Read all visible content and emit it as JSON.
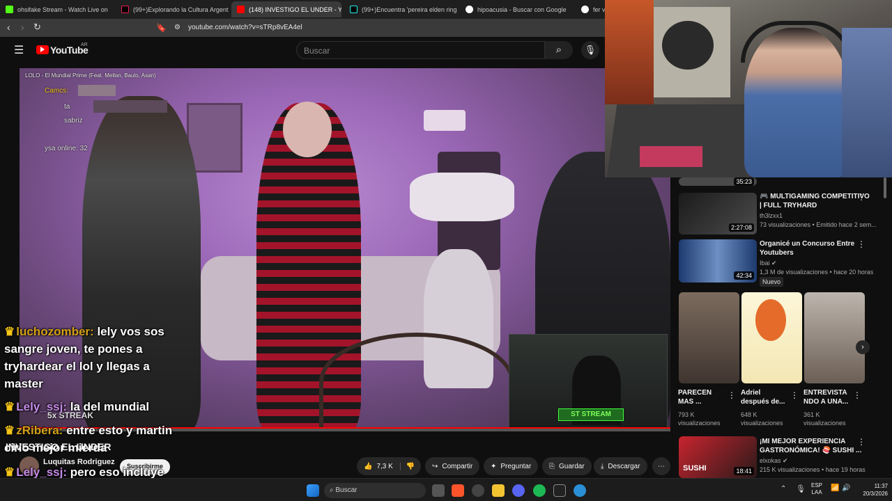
{
  "browser": {
    "tabs": [
      {
        "title": "ohsifake Stream - Watch Live on",
        "active": false
      },
      {
        "title": "(99+)Explorando la Cultura Argentina",
        "active": false
      },
      {
        "title": "(148) INVESTIGO EL UNDER - You",
        "active": true
      },
      {
        "title": "(99+)Encuentra 'pereira elden ring'",
        "active": false
      },
      {
        "title": "hipoacusia - Buscar con Google",
        "active": false
      },
      {
        "title": "fer vaz",
        "active": false
      }
    ],
    "url": "youtube.com/watch?v=sTRp8vEA4el"
  },
  "youtube": {
    "logo_text": "YouTube",
    "region": "AR",
    "search_placeholder": "Buscar"
  },
  "video": {
    "overlay_song": "LOLO - El Mundial Prime (Feat. Mellan, Baulo, Asan)",
    "overlay_users": [
      "Camcs:",
      "ta",
      "sabriz",
      "ysa online: 32"
    ],
    "streak": "5x STREAK",
    "cam_label": "ST STREAM",
    "chat": [
      {
        "user": "luchozomber:",
        "text": "lely vos sos sangre joven, te pones a tryhardear el lol y llegas a master"
      },
      {
        "user": "Lely_ssj:",
        "text": "la del mundial"
      },
      {
        "user": "zRibera:",
        "text": "entre esto y martin cirio mejor mierda"
      },
      {
        "user": "Lely_ssj:",
        "text": "pero eso incluye engordar y no me va"
      }
    ]
  },
  "channel": {
    "name": "Luquitas Rodriguez",
    "subscribe": "Suscribirme",
    "video_title": "INVESTIGO EL UNDER"
  },
  "actions": {
    "likes": "7,3 K",
    "share": "Compartir",
    "ask": "Preguntar",
    "save": "Guardar",
    "download": "Descargar"
  },
  "sidebar": {
    "top_duration": "35:23",
    "items": [
      {
        "title": "MULTIGAMING COMPETITIVO | FULL TRYHARD",
        "channel": "th3lzxx1",
        "meta": "73 visualizaciones • Emitido hace 2 sem...",
        "duration": "2:27:08",
        "badge": ""
      },
      {
        "title": "Organicé un Concurso Entre Youtubers",
        "channel": "Ibai",
        "meta": "1,3 M de visualizaciones • hace 20 horas",
        "duration": "42:34",
        "badge": "Nuevo"
      }
    ],
    "shorts": [
      {
        "title": "PARECEN MAS ...",
        "views": "793 K visualizaciones"
      },
      {
        "title": "Adriel después de...",
        "views": "648 K visualizaciones"
      },
      {
        "title": "ENTREVISTA NDO A UNA...",
        "views": "361 K visualizaciones"
      }
    ],
    "bottom": {
      "title": "¡MI MEJOR EXPERIENCIA GASTRONÓMICA! 🍣 SUSHI ...",
      "channel": "elxokas",
      "meta": "215 K visualizaciones • hace 19 horas",
      "duration": "18:41",
      "thumb_text": "SUSHI"
    }
  },
  "taskbar": {
    "search": "Buscar",
    "lang": "ESP",
    "lang2": "LAA",
    "time": "11:37",
    "date": "20/3/2026"
  }
}
